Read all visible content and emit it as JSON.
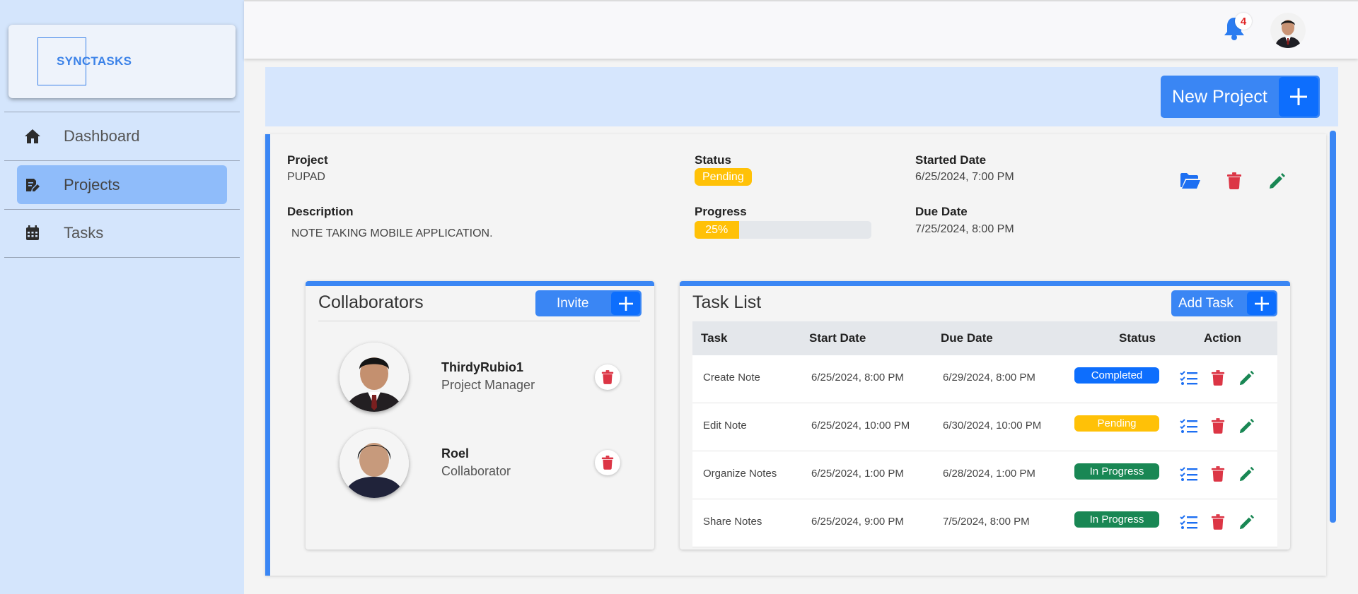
{
  "brand": {
    "name": "SYNCTASKS"
  },
  "sidebar": {
    "items": [
      {
        "label": "Dashboard",
        "icon": "home-icon"
      },
      {
        "label": "Projects",
        "icon": "edit-document-icon"
      },
      {
        "label": "Tasks",
        "icon": "calendar-icon"
      }
    ]
  },
  "topbar": {
    "notifications_count": "4"
  },
  "banner": {
    "new_project_label": "New Project"
  },
  "project": {
    "project_label": "Project",
    "project_value": "PUPAD",
    "description_label": "Description",
    "description_value": "NOTE TAKING MOBILE APPLICATION.",
    "status_label": "Status",
    "status_value": "Pending",
    "progress_label": "Progress",
    "progress_value": "25%",
    "started_label": "Started Date",
    "started_value": "6/25/2024, 7:00 PM",
    "due_label": "Due Date",
    "due_value": "7/25/2024, 8:00 PM"
  },
  "collaborators": {
    "title": "Collaborators",
    "invite_label": "Invite",
    "people": [
      {
        "name": "ThirdyRubio1",
        "role": "Project Manager"
      },
      {
        "name": "Roel",
        "role": "Collaborator"
      }
    ]
  },
  "tasks": {
    "title": "Task List",
    "add_label": "Add Task",
    "headers": {
      "task": "Task",
      "start": "Start Date",
      "due": "Due Date",
      "status": "Status",
      "action": "Action"
    },
    "rows": [
      {
        "task": "Create Note",
        "start": "6/25/2024, 8:00 PM",
        "due": "6/29/2024, 8:00 PM",
        "status": "Completed"
      },
      {
        "task": "Edit Note",
        "start": "6/25/2024, 10:00 PM",
        "due": "6/30/2024, 10:00 PM",
        "status": "Pending"
      },
      {
        "task": "Organize Notes",
        "start": "6/25/2024, 1:00 PM",
        "due": "6/28/2024, 1:00 PM",
        "status": "In Progress"
      },
      {
        "task": "Share Notes",
        "start": "6/25/2024, 9:00 PM",
        "due": "7/5/2024, 8:00 PM",
        "status": "In Progress"
      }
    ]
  },
  "colors": {
    "accent": "#3a86f4",
    "primary_dark": "#0d6efd",
    "sidebar_bg": "#d4e5fc",
    "pending": "#ffc107",
    "completed": "#0d6efd",
    "in_progress": "#198754",
    "danger": "#dc3545",
    "success": "#198754"
  }
}
